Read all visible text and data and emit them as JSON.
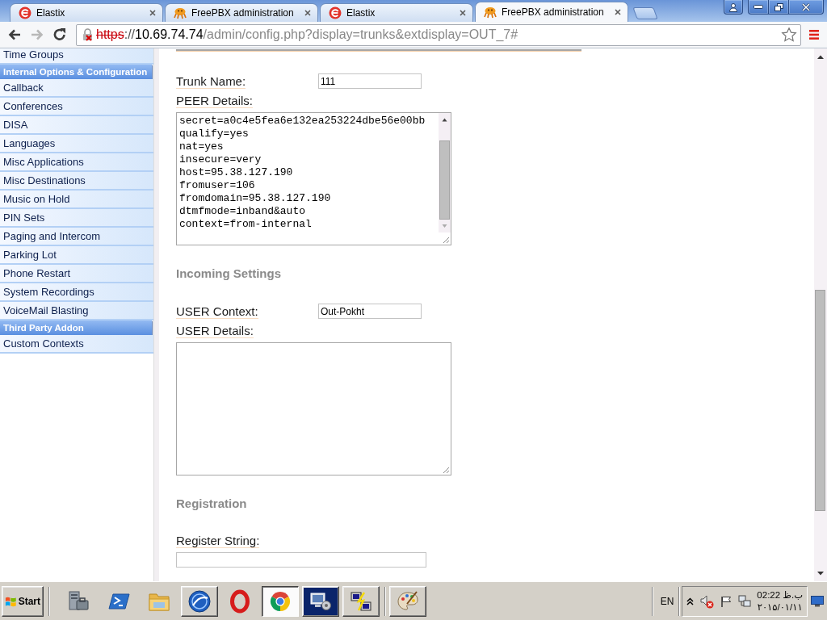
{
  "browser": {
    "tabs": [
      {
        "title": "Elastix",
        "kind": "swirl",
        "selected": false
      },
      {
        "title": "FreePBX administration",
        "kind": "mascot",
        "selected": false
      },
      {
        "title": "Elastix",
        "kind": "swirl",
        "selected": false
      },
      {
        "title": "FreePBX administration",
        "kind": "mascot",
        "selected": true
      }
    ],
    "nav_buttons": [
      {
        "kind": "back",
        "disabled": false
      },
      {
        "kind": "forward",
        "disabled": true
      },
      {
        "kind": "reload",
        "disabled": false
      }
    ],
    "address": {
      "certificate_error": true,
      "scheme": "https",
      "separator": "://",
      "host": "10.69.74.74",
      "path": "/admin/config.php?display=trunks&extdisplay=OUT_7#"
    },
    "bookmarked": false,
    "menu_alert": true
  },
  "sidebar": {
    "sections": [
      {
        "items": [
          {
            "label": "Time Groups",
            "selected": false
          }
        ]
      },
      {
        "title": "Internal Options & Configuration",
        "items": [
          {
            "label": "Callback",
            "selected": false
          },
          {
            "label": "Conferences",
            "selected": false
          },
          {
            "label": "DISA",
            "selected": false
          },
          {
            "label": "Languages",
            "selected": false
          },
          {
            "label": "Misc Applications",
            "selected": false
          },
          {
            "label": "Misc Destinations",
            "selected": false
          },
          {
            "label": "Music on Hold",
            "selected": false
          },
          {
            "label": "PIN Sets",
            "selected": false
          },
          {
            "label": "Paging and Intercom",
            "selected": false
          },
          {
            "label": "Parking Lot",
            "selected": false
          },
          {
            "label": "Phone Restart",
            "selected": false
          },
          {
            "label": "System Recordings",
            "selected": false
          },
          {
            "label": "VoiceMail Blasting",
            "selected": false
          }
        ]
      },
      {
        "title": "Third Party Addon",
        "items": [
          {
            "label": "Custom Contexts",
            "selected": false
          }
        ]
      }
    ]
  },
  "form": {
    "rows": [
      {
        "kind": "field",
        "label": "Trunk Name:",
        "value": "111"
      },
      {
        "kind": "textarea",
        "label": "PEER Details:",
        "value": "secret=a0c4e5fea6e132ea253224dbe56e00bb\nqualify=yes\nnat=yes\ninsecure=very\nhost=95.38.127.190\nfromuser=106\nfromdomain=95.38.127.190\ndtmfmode=inband&auto\ncontext=from-internal",
        "scrollable": true
      },
      {
        "kind": "heading",
        "text": "Incoming Settings"
      },
      {
        "kind": "field",
        "label": "USER Context:",
        "value": "Out-Pokht"
      },
      {
        "kind": "textarea",
        "label": "USER Details:",
        "scrollable": false
      },
      {
        "kind": "heading",
        "text": "Registration"
      },
      {
        "kind": "wide_field",
        "label": "Register String:"
      }
    ]
  },
  "taskbar": {
    "start": "Start",
    "groups": [
      {
        "buttons": [
          {
            "kind": "server",
            "running": false,
            "selected": false,
            "flashing": false
          },
          {
            "kind": "terminal",
            "running": false,
            "selected": false,
            "flashing": false
          },
          {
            "kind": "folder",
            "running": false,
            "selected": false,
            "flashing": false
          },
          {
            "kind": "disc",
            "running": true,
            "selected": false,
            "flashing": false
          },
          {
            "kind": "ring",
            "running": false,
            "selected": false,
            "flashing": false
          },
          {
            "kind": "wheel",
            "running": true,
            "selected": true,
            "flashing": false
          },
          {
            "kind": "computer",
            "running": true,
            "selected": false,
            "flashing": true
          },
          {
            "kind": "network",
            "running": true,
            "selected": false,
            "flashing": false
          }
        ]
      },
      {
        "buttons": [
          {
            "kind": "palette",
            "running": true,
            "selected": false,
            "flashing": false
          }
        ]
      }
    ],
    "language": "EN",
    "clock": {
      "time": "02:22 ب.ظ",
      "date": "۲۰۱۵/۰۱/۱۱"
    }
  }
}
